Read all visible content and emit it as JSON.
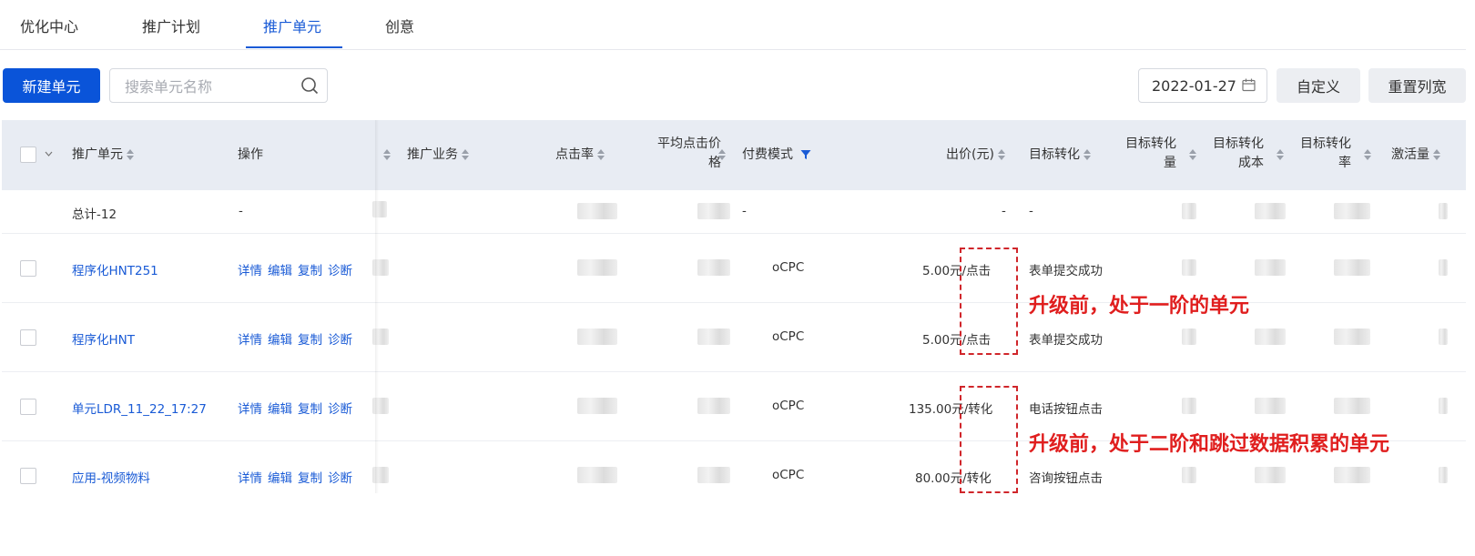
{
  "tabs": [
    "优化中心",
    "推广计划",
    "推广单元",
    "创意"
  ],
  "toolbar": {
    "new_unit": "新建单元",
    "search_placeholder": "搜索单元名称",
    "date": "2022-01-27",
    "customize": "自定义",
    "reset_width": "重置列宽"
  },
  "columns": {
    "unit": "推广单元",
    "ops": "操作",
    "business": "推广业务",
    "ctr": "点击率",
    "avg_cpc_1": "平均点击价",
    "avg_cpc_2": "格",
    "pay_mode": "付费模式",
    "bid": "出价(元)",
    "target": "目标转化",
    "target_vol_1": "目标转化",
    "target_vol_2": "量",
    "target_cost_1": "目标转化",
    "target_cost_2": "成本",
    "target_rate_1": "目标转化",
    "target_rate_2": "率",
    "activation": "激活量"
  },
  "total_row": {
    "label": "总计-12",
    "ops": "-",
    "pay_mode": "-",
    "bid": "-",
    "target": "-"
  },
  "op_labels": [
    "详情",
    "编辑",
    "复制",
    "诊断"
  ],
  "rows": [
    {
      "name": "程序化HNT251",
      "pay_mode": "oCPC",
      "bid": "5.00元/点击",
      "target": "表单提交成功"
    },
    {
      "name": "程序化HNT",
      "pay_mode": "oCPC",
      "bid": "5.00元/点击",
      "target": "表单提交成功"
    },
    {
      "name": "单元LDR_11_22_17:27",
      "pay_mode": "oCPC",
      "bid": "135.00元/转化",
      "target": "电话按钮点击"
    },
    {
      "name": "应用-视频物料",
      "pay_mode": "oCPC",
      "bid": "80.00元/转化",
      "target": "咨询按钮点击"
    }
  ],
  "annotations": {
    "first": "升级前，处于一阶的单元",
    "second": "升级前，处于二阶和跳过数据积累的单元"
  },
  "colors": {
    "accent": "#1a5bd6",
    "primary_button": "#0a54d9",
    "annotation": "#e01e1e"
  },
  "icons": [
    "search-icon",
    "calendar-icon",
    "sort-icon",
    "filter-icon",
    "chevron-down-icon"
  ]
}
